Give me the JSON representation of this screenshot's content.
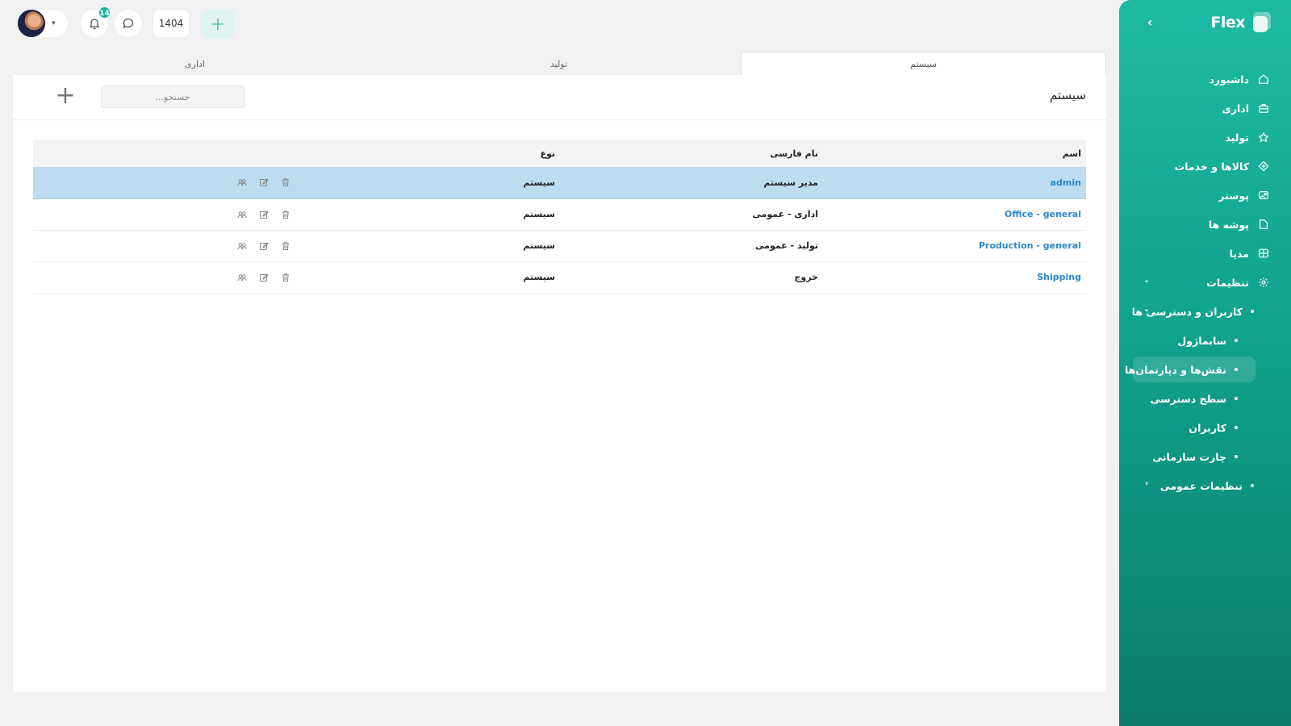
{
  "app": {
    "brand": "Flex"
  },
  "topbar": {
    "notification_count": "14",
    "year": "1404",
    "add_label": "+"
  },
  "sidebar": {
    "items": [
      {
        "label": "داشبورد",
        "icon": "home-icon"
      },
      {
        "label": "اداری",
        "icon": "briefcase-icon"
      },
      {
        "label": "تولید",
        "icon": "factory-icon"
      },
      {
        "label": "کالاها و خدمات",
        "icon": "box-icon"
      },
      {
        "label": "پوستر",
        "icon": "image-icon"
      },
      {
        "label": "پوشه ها",
        "icon": "folder-icon"
      },
      {
        "label": "مدیا",
        "icon": "media-icon"
      },
      {
        "label": "تنظیمات",
        "icon": "gear-icon"
      }
    ],
    "settings_children": {
      "users_access": "کاربران و دسترسی ها",
      "users_access_children": [
        "سابماژول",
        "نقش‌ها و دپارتمان‌ها",
        "سطح دسترسی",
        "کاربران",
        "چارت سازمانی"
      ],
      "general_settings": "تنظیمات عمومی"
    }
  },
  "tabs": [
    "سیستم",
    "تولید",
    "اداری"
  ],
  "active_tab": "سیستم",
  "card": {
    "title": "سیستم",
    "search_placeholder": "جستجو..."
  },
  "table": {
    "headers": [
      "اسم",
      "نام فارسی",
      "نوع"
    ],
    "rows": [
      {
        "name": "admin",
        "persian_name": "مدیر سیستم",
        "type": "سیستم",
        "selected": true
      },
      {
        "name": "Office - general",
        "persian_name": "اداری - عمومی",
        "type": "سیستم",
        "selected": false
      },
      {
        "name": "Production - general",
        "persian_name": "تولید - عمومی",
        "type": "سیستم",
        "selected": false
      },
      {
        "name": "Shipping",
        "persian_name": "خروج",
        "type": "سیستم",
        "selected": false
      }
    ]
  },
  "colors": {
    "accent": "#13b59e",
    "selected_row": "#bcdcf2",
    "link": "#2b87c9"
  }
}
